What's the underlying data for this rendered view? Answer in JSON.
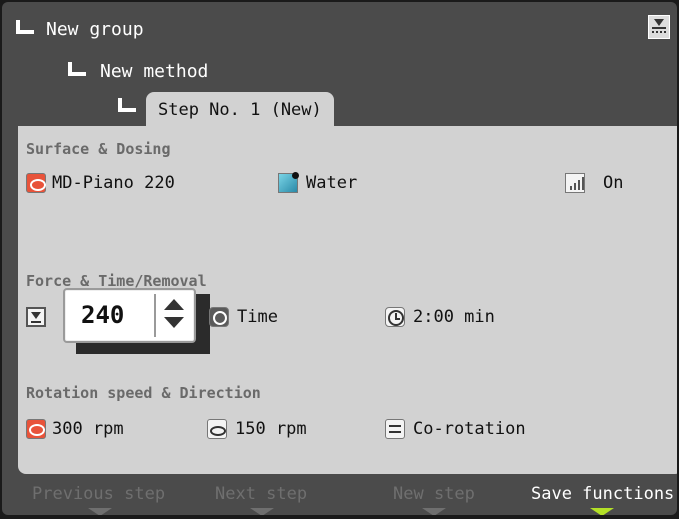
{
  "header": {
    "tree": [
      {
        "label": "New group"
      },
      {
        "label": "New method"
      }
    ],
    "step_tab": "Step No. 1 (New)",
    "save_icon": "save-download-icon"
  },
  "surface": {
    "title": "Surface & Dosing",
    "surface_label": "MD-Piano 220",
    "lubricant_label": "Water",
    "dosing_label": "On"
  },
  "force": {
    "title": "Force & Time/Removal",
    "value": "240",
    "mode_label": "Time",
    "time_label": "2:00 min"
  },
  "rotation": {
    "title": "Rotation speed & Direction",
    "disc_speed": "300 rpm",
    "head_speed": "150 rpm",
    "direction": "Co-rotation"
  },
  "softkeys": [
    {
      "label": "Previous step",
      "active": false
    },
    {
      "label": "Next step",
      "active": false
    },
    {
      "label": "New step",
      "active": false
    },
    {
      "label": "Save functions",
      "active": true
    }
  ],
  "colors": {
    "background": "#4b4b4b",
    "panel": "#d2d2d2",
    "accent_red": "#e8533a",
    "active_arrow": "#b3e027",
    "dim_text": "#6f6f6f"
  }
}
